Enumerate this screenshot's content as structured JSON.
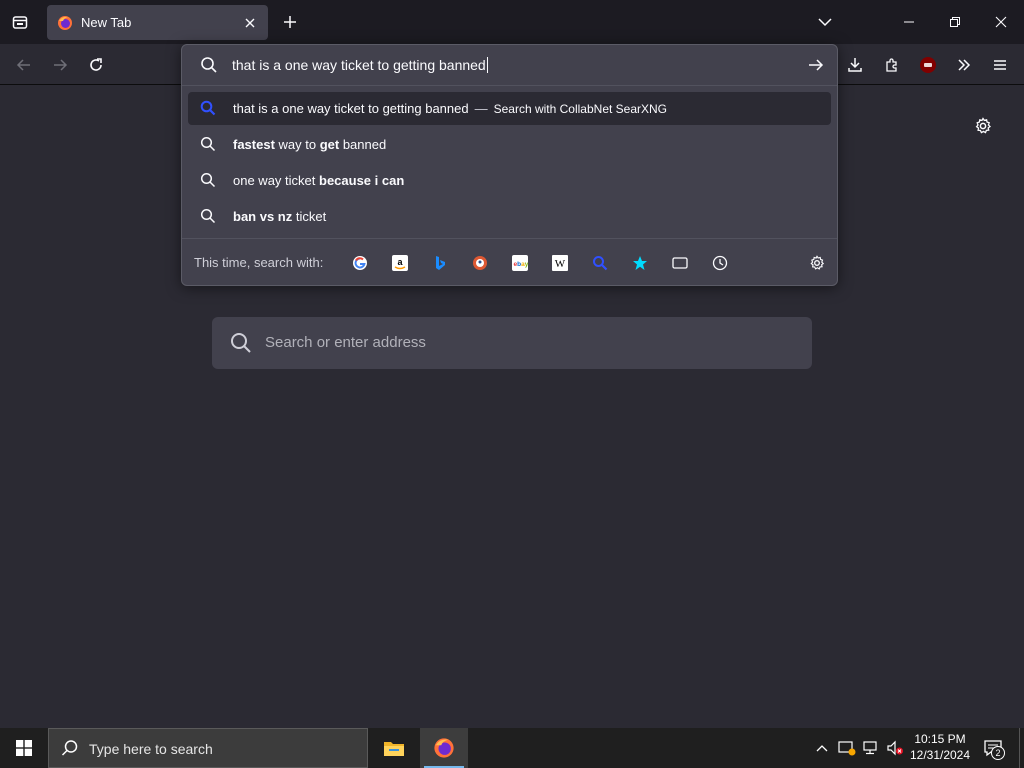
{
  "tab": {
    "title": "New Tab",
    "close_label": "×"
  },
  "urlbar": {
    "value": "that is a one way ticket to getting banned"
  },
  "results": [
    {
      "parts": [
        {
          "t": "that is a one way ticket to getting banned",
          "b": false
        }
      ],
      "separator": "—",
      "action": "Search with CollabNet SearXNG",
      "selected": true
    },
    {
      "parts": [
        {
          "t": "fastest",
          "b": true
        },
        {
          "t": " way to ",
          "b": false
        },
        {
          "t": "get",
          "b": true
        },
        {
          "t": " banned",
          "b": false
        }
      ]
    },
    {
      "parts": [
        {
          "t": "one way ticket ",
          "b": false
        },
        {
          "t": "because i can",
          "b": true
        }
      ]
    },
    {
      "parts": [
        {
          "t": "ban vs nz",
          "b": true
        },
        {
          "t": " ticket",
          "b": false
        }
      ]
    }
  ],
  "oneoffs": {
    "label": "This time, search with:",
    "engines": [
      "google-icon",
      "amazon-icon",
      "bing-icon",
      "duckduckgo-icon",
      "ebay-icon",
      "wikipedia-icon",
      "searxng-icon",
      "bookmarks-icon",
      "tabs-icon",
      "history-icon"
    ]
  },
  "page": {
    "search_placeholder": "Search or enter address"
  },
  "taskbar": {
    "search_placeholder": "Type here to search",
    "time": "10:15 PM",
    "date": "12/31/2024",
    "notification_count": "2"
  },
  "colors": {
    "accent": "#0060df",
    "searx": "#3050ff",
    "ublock": "#800000"
  }
}
